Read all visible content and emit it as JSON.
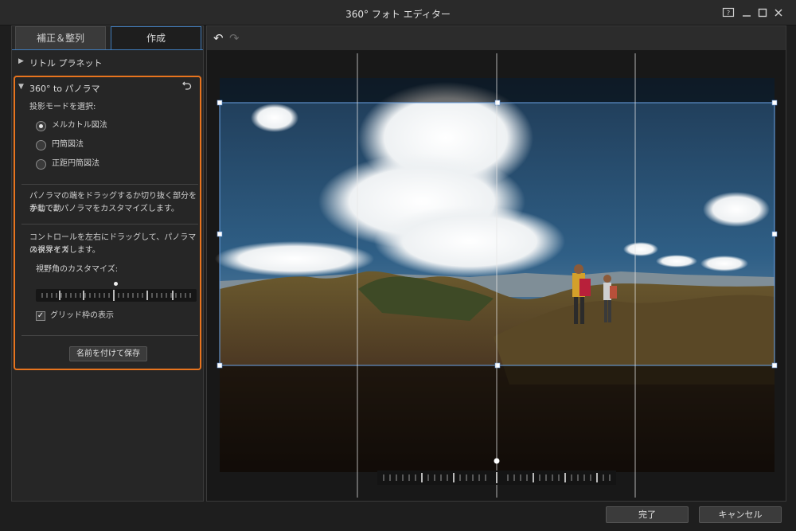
{
  "window": {
    "title": "360° フォト エディター"
  },
  "tabs": [
    {
      "label": "補正＆整列"
    },
    {
      "label": "作成"
    }
  ],
  "sections": {
    "little_planet": "リトル プラネット",
    "panorama": "360° to パノラマ"
  },
  "panorama": {
    "mode_label": "投影モードを選択:",
    "modes": [
      {
        "label": "メルカトル図法",
        "selected": true
      },
      {
        "label": "円筒図法",
        "selected": false
      },
      {
        "label": "正距円筒図法",
        "selected": false
      }
    ],
    "desc1_line1": "パノラマの端をドラッグするか切り抜く部分を手動で動",
    "desc1_line2": "かして、パノラマをカスタマイズします。",
    "desc2_line1": "コントロールを左右にドラッグして、パノラマの視界をカ",
    "desc2_line2": "スタマイズします。",
    "fov_label": "視野角のカスタマイズ:",
    "grid_label": "グリッド枠の表示",
    "grid_checked": true,
    "save_label": "名前を付けて保存"
  },
  "footer": {
    "done_label": "完了",
    "cancel_label": "キャンセル"
  },
  "colors": {
    "accent_orange": "#e8741e",
    "accent_blue": "#3f7ab8",
    "selection_blue": "#5ea2ff"
  },
  "icons": {
    "undo": "undo-icon",
    "redo": "redo-icon",
    "reset": "reset-icon"
  }
}
